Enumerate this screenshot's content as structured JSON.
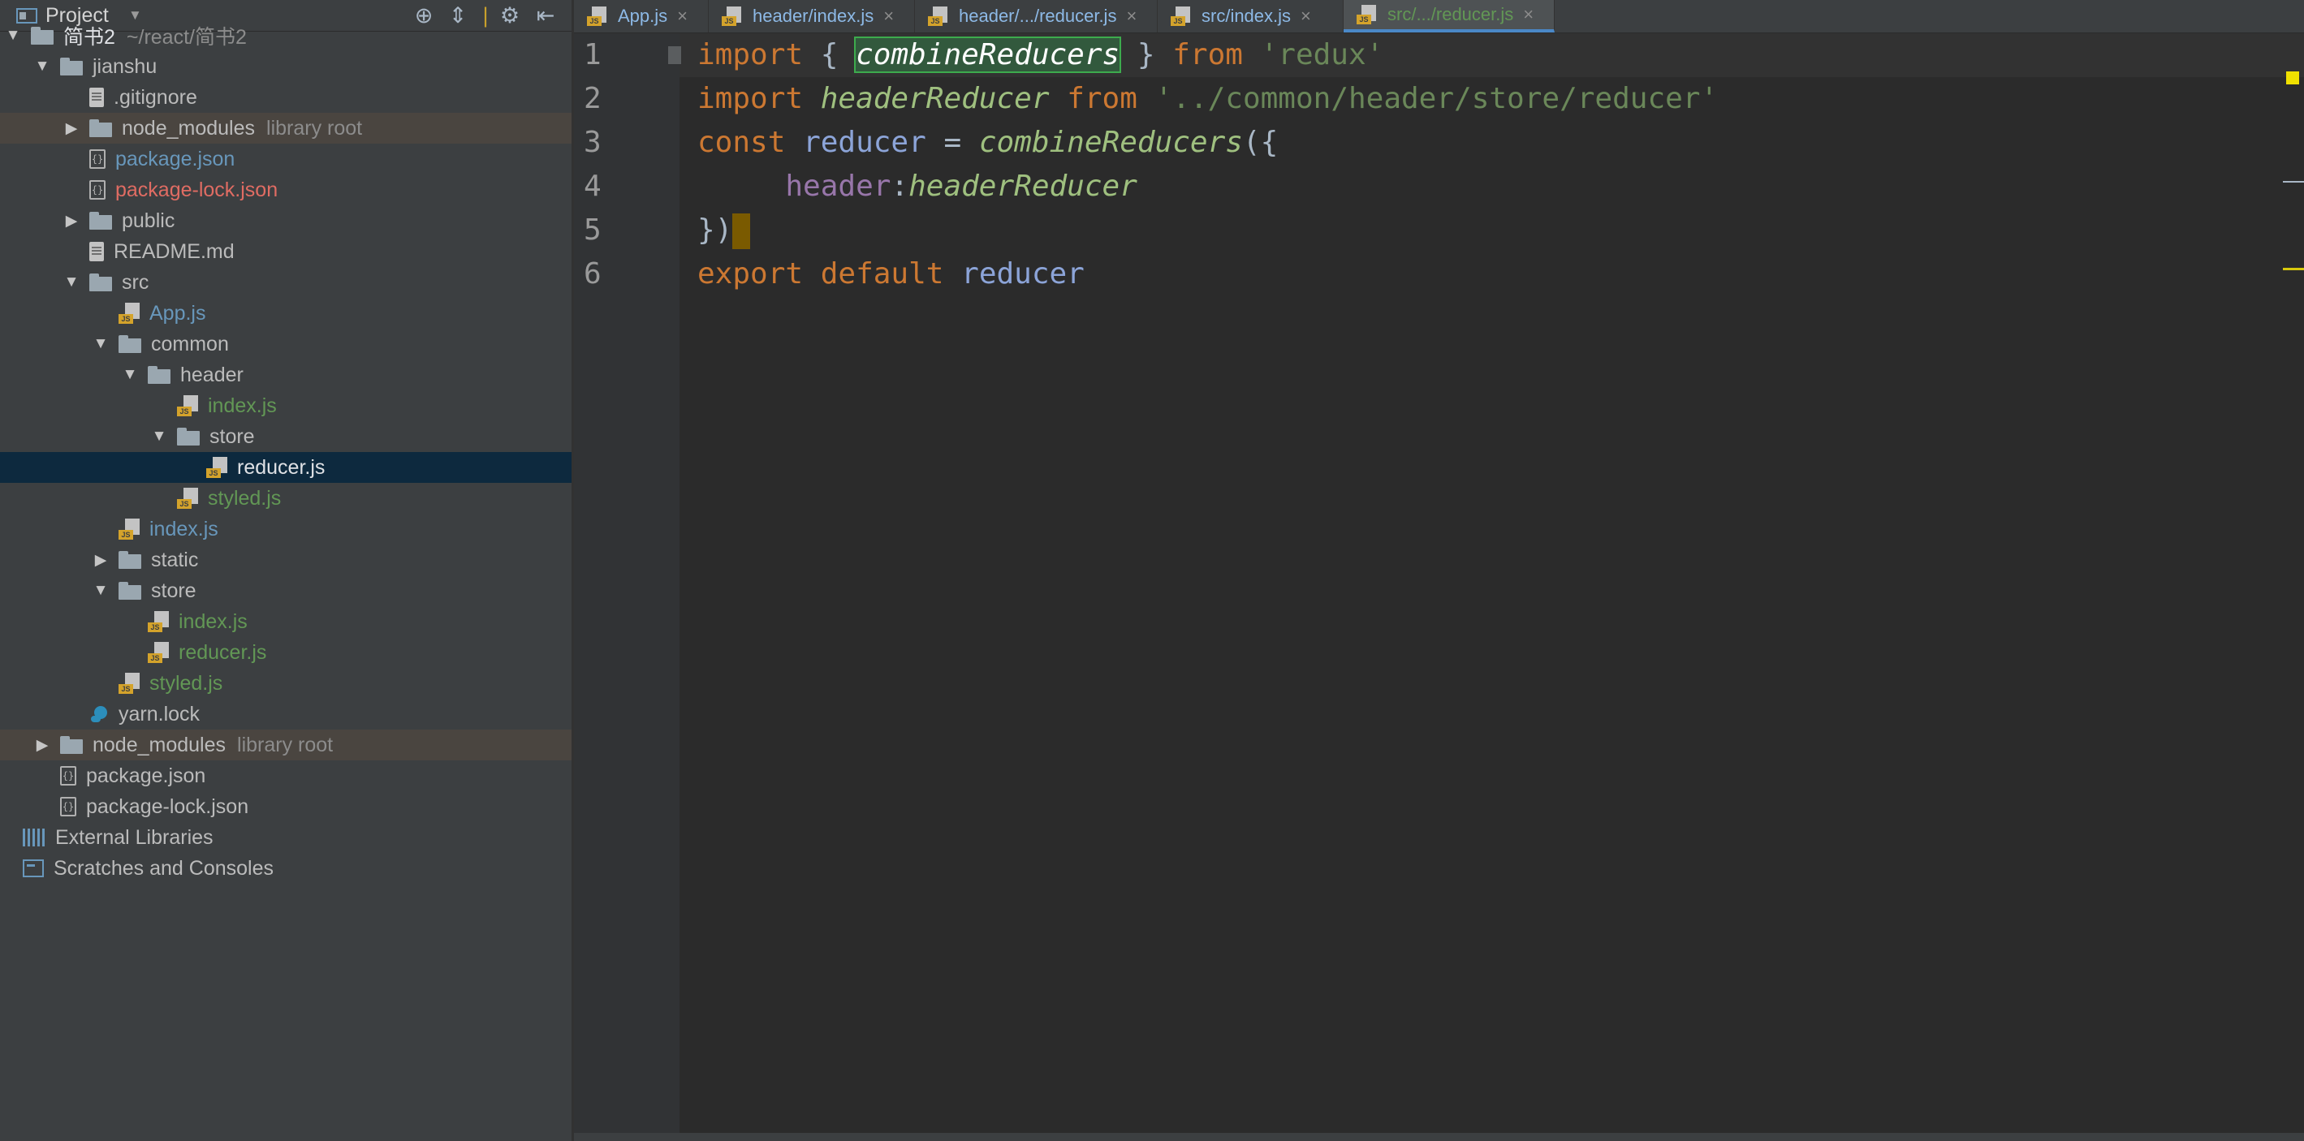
{
  "panel": {
    "title": "Project",
    "toolbar_icons": [
      "locate-icon",
      "collapse-icon",
      "divider",
      "gear-icon",
      "hide-icon"
    ]
  },
  "tree": [
    {
      "label": "简书2",
      "hint": "~/react/简书2",
      "level": 0,
      "expanded": true,
      "icon": "folder",
      "color": "white"
    },
    {
      "label": "jianshu",
      "level": 1,
      "expanded": true,
      "icon": "folder"
    },
    {
      "label": ".gitignore",
      "level": 2,
      "icon": "file"
    },
    {
      "label": "node_modules",
      "hint": "library root",
      "level": 2,
      "expanded": false,
      "icon": "folder",
      "lib": true
    },
    {
      "label": "package.json",
      "level": 2,
      "icon": "json",
      "color": "blue"
    },
    {
      "label": "package-lock.json",
      "level": 2,
      "icon": "json",
      "color": "red"
    },
    {
      "label": "public",
      "level": 2,
      "expanded": false,
      "icon": "folder"
    },
    {
      "label": "README.md",
      "level": 2,
      "icon": "file"
    },
    {
      "label": "src",
      "level": 2,
      "expanded": true,
      "icon": "folder"
    },
    {
      "label": "App.js",
      "level": 3,
      "icon": "js",
      "color": "blue"
    },
    {
      "label": "common",
      "level": 3,
      "expanded": true,
      "icon": "folder"
    },
    {
      "label": "header",
      "level": 4,
      "expanded": true,
      "icon": "folder"
    },
    {
      "label": "index.js",
      "level": 5,
      "icon": "js",
      "color": "green"
    },
    {
      "label": "store",
      "level": 5,
      "expanded": true,
      "icon": "folder"
    },
    {
      "label": "reducer.js",
      "level": 6,
      "icon": "js",
      "selected": true
    },
    {
      "label": "styled.js",
      "level": 5,
      "icon": "js",
      "color": "green"
    },
    {
      "label": "index.js",
      "level": 3,
      "icon": "js",
      "color": "blue"
    },
    {
      "label": "static",
      "level": 3,
      "expanded": false,
      "icon": "folder"
    },
    {
      "label": "store",
      "level": 3,
      "expanded": true,
      "icon": "folder"
    },
    {
      "label": "index.js",
      "level": 4,
      "icon": "js",
      "color": "green"
    },
    {
      "label": "reducer.js",
      "level": 4,
      "icon": "js",
      "color": "green"
    },
    {
      "label": "styled.js",
      "level": 3,
      "icon": "js",
      "color": "green"
    },
    {
      "label": "yarn.lock",
      "level": 2,
      "icon": "yarn"
    },
    {
      "label": "node_modules",
      "hint": "library root",
      "level": 1,
      "expanded": false,
      "icon": "folder",
      "lib": true
    },
    {
      "label": "package.json",
      "level": 1,
      "icon": "json"
    },
    {
      "label": "package-lock.json",
      "level": 1,
      "icon": "json"
    },
    {
      "label": "External Libraries",
      "level": 0,
      "icon": "extlib",
      "noarrow": true
    },
    {
      "label": "Scratches and Consoles",
      "level": 0,
      "icon": "scratch",
      "noarrow": true
    }
  ],
  "tabs": [
    {
      "label": "App.js",
      "active": false
    },
    {
      "label": "header/index.js",
      "active": false
    },
    {
      "label": "header/.../reducer.js",
      "active": false
    },
    {
      "label": "src/index.js",
      "active": false
    },
    {
      "label": "src/.../reducer.js",
      "active": true
    }
  ],
  "tab_close_glyph": "×",
  "editor": {
    "line_numbers": [
      "1",
      "2",
      "3",
      "4",
      "5",
      "6"
    ],
    "lines": [
      [
        {
          "t": "import",
          "c": "kw"
        },
        {
          "t": " { "
        },
        {
          "t": "combineReducers",
          "c": "fn hl"
        },
        {
          "t": " } "
        },
        {
          "t": "from",
          "c": "kw"
        },
        {
          "t": " "
        },
        {
          "t": "'redux'",
          "c": "str"
        }
      ],
      [
        {
          "t": "import",
          "c": "kw"
        },
        {
          "t": " "
        },
        {
          "t": "headerReducer",
          "c": "fn"
        },
        {
          "t": " "
        },
        {
          "t": "from",
          "c": "kw"
        },
        {
          "t": " "
        },
        {
          "t": "'../common/header/store/reducer'",
          "c": "str"
        }
      ],
      [
        {
          "t": "const",
          "c": "kw"
        },
        {
          "t": " "
        },
        {
          "t": "reducer",
          "c": "var"
        },
        {
          "t": " = "
        },
        {
          "t": "combineReducers",
          "c": "fn"
        },
        {
          "t": "({"
        }
      ],
      [
        {
          "t": "     "
        },
        {
          "t": "header",
          "c": "prop"
        },
        {
          "t": ":"
        },
        {
          "t": "headerReducer",
          "c": "fn"
        }
      ],
      [
        {
          "t": "})"
        },
        {
          "t": "",
          "c": "cursor"
        }
      ],
      [
        {
          "t": "export",
          "c": "kw"
        },
        {
          "t": " "
        },
        {
          "t": "default",
          "c": "kw"
        },
        {
          "t": " "
        },
        {
          "t": "reducer",
          "c": "var"
        }
      ]
    ]
  }
}
